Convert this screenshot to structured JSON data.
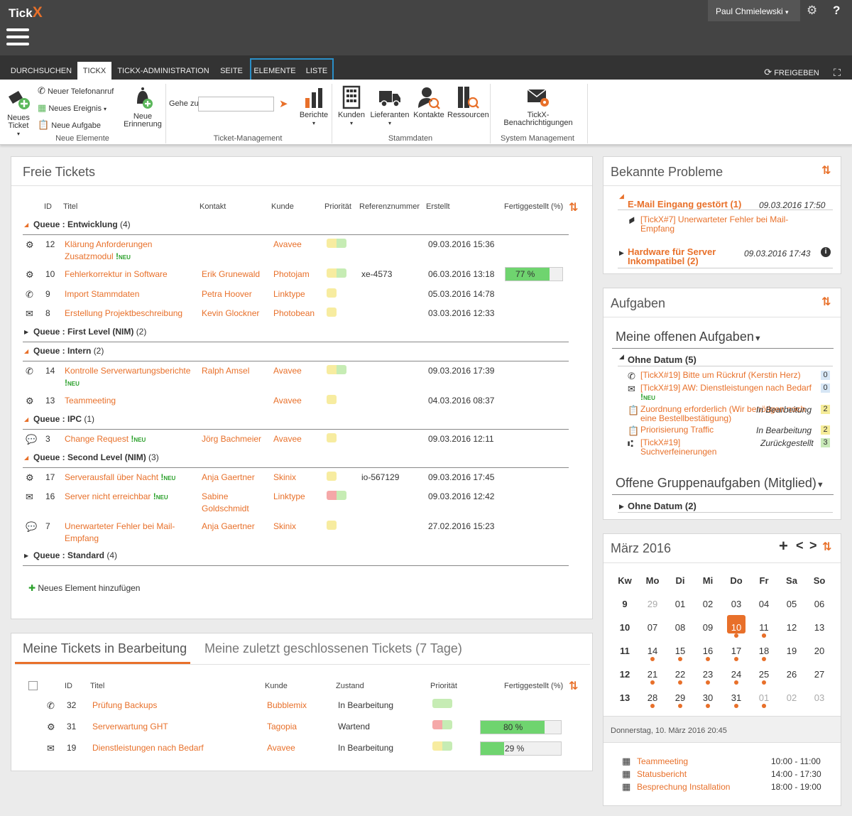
{
  "app": {
    "logo_text": "Tick",
    "logo_x": "X",
    "user": "Paul Chmielewski",
    "settings_icon": "gear-icon",
    "help_icon": "?"
  },
  "tabs": [
    {
      "label": "DURCHSUCHEN"
    },
    {
      "label": "TICKX"
    },
    {
      "label": "TICKX-ADMINISTRATION"
    },
    {
      "label": "SEITE"
    },
    {
      "label": "ELEMENTE"
    },
    {
      "label": "LISTE"
    }
  ],
  "toolbar_right": {
    "share": "FREIGEBEN"
  },
  "ribbon": {
    "neues_ticket": "Neues Ticket",
    "neuer_telefonanruf": "Neuer Telefonanruf",
    "neues_ereignis": "Neues Ereignis",
    "neue_aufgabe": "Neue Aufgabe",
    "neue_erinnerung": "Neue Erinnerung",
    "group_neue": "Neue Elemente",
    "gehe_zu": "Gehe zu",
    "berichte": "Berichte",
    "group_ticket": "Ticket-Management",
    "kunden": "Kunden",
    "lieferanten": "Lieferanten",
    "kontakte": "Kontakte",
    "ressourcen": "Ressourcen",
    "group_stamm": "Stammdaten",
    "benachrichtigungen": "TickX-Benachrichtigungen",
    "group_system": "System Management"
  },
  "freie": {
    "title": "Freie Tickets",
    "add": "Neues Element hinzufügen",
    "headers": {
      "id": "ID",
      "titel": "Titel",
      "kontakt": "Kontakt",
      "kunde": "Kunde",
      "prio": "Priorität",
      "ref": "Referenznummer",
      "erstellt": "Erstellt",
      "fertig": "Fertiggestellt (%)"
    },
    "queues": [
      {
        "name": "Queue : Entwicklung",
        "count": "(4)"
      },
      {
        "name": "Queue : First Level (NIM)",
        "count": "(2)"
      },
      {
        "name": "Queue : Intern",
        "count": "(2)"
      },
      {
        "name": "Queue : IPC",
        "count": "(1)"
      },
      {
        "name": "Queue : Second Level (NIM)",
        "count": "(3)"
      },
      {
        "name": "Queue : Standard",
        "count": "(4)"
      }
    ],
    "rows": [
      {
        "id": "12",
        "titel": "Klärung Anforderungen Zusatzmodul",
        "kontakt": "",
        "kunde": "Avavee",
        "ref": "",
        "erstellt": "09.03.2016 15:36"
      },
      {
        "id": "10",
        "titel": "Fehlerkorrektur in Software",
        "kontakt": "Erik Grunewald",
        "kunde": "Photojam",
        "ref": "xe-4573",
        "erstellt": "06.03.2016 13:18",
        "fertig": "77 %",
        "fertig_value": 77
      },
      {
        "id": "9",
        "titel": "Import Stammdaten",
        "kontakt": "Petra Hoover",
        "kunde": "Linktype",
        "ref": "",
        "erstellt": "05.03.2016 14:78"
      },
      {
        "id": "8",
        "titel": "Erstellung Projektbeschreibung",
        "kontakt": "Kevin Glockner",
        "kunde": "Photobean",
        "ref": "",
        "erstellt": "03.03.2016 12:33"
      },
      {
        "id": "14",
        "titel": "Kontrolle Serverwartungsberichte",
        "kontakt": "Ralph Amsel",
        "kunde": "Avavee",
        "ref": "",
        "erstellt": "09.03.2016 17:39"
      },
      {
        "id": "13",
        "titel": "Teammeeting",
        "kontakt": "",
        "kunde": "Avavee",
        "ref": "",
        "erstellt": "04.03.2016 08:37"
      },
      {
        "id": "3",
        "titel": "Change Request",
        "kontakt": "Jörg Bachmeier",
        "kunde": "Avavee",
        "ref": "",
        "erstellt": "09.03.2016 12:11"
      },
      {
        "id": "17",
        "titel": "Serverausfall über Nacht",
        "kontakt": "Anja Gaertner",
        "kunde": "Skinix",
        "ref": "io-567129",
        "erstellt": "09.03.2016 17:45"
      },
      {
        "id": "16",
        "titel": "Server nicht erreichbar",
        "kontakt": "Sabine Goldschmidt",
        "kunde": "Linktype",
        "ref": "",
        "erstellt": "09.03.2016 12:42"
      },
      {
        "id": "7",
        "titel": "Unerwarteter Fehler bei Mail-Empfang",
        "kontakt": "Anja Gaertner",
        "kunde": "Skinix",
        "ref": "",
        "erstellt": "27.02.2016 15:23"
      }
    ],
    "neu_mark": "!",
    "neu_text": "NEU"
  },
  "meine": {
    "tab1": "Meine Tickets in Bearbeitung",
    "tab2": "Meine zuletzt geschlossenen Tickets (7 Tage)",
    "headers": {
      "id": "ID",
      "titel": "Titel",
      "kunde": "Kunde",
      "zustand": "Zustand",
      "prio": "Priorität",
      "fertig": "Fertiggestellt (%)"
    },
    "rows": [
      {
        "id": "32",
        "titel": "Prüfung Backups",
        "kunde": "Bubblemix",
        "zustand": "In Bearbeitung"
      },
      {
        "id": "31",
        "titel": "Serverwartung GHT",
        "kunde": "Tagopia",
        "zustand": "Wartend",
        "fertig": "80 %",
        "fertig_value": 80
      },
      {
        "id": "19",
        "titel": "Dienstleistungen nach Bedarf",
        "kunde": "Avavee",
        "zustand": "In Bearbeitung",
        "fertig": "29 %",
        "fertig_value": 29
      }
    ]
  },
  "probleme": {
    "title": "Bekannte Probleme",
    "items": [
      {
        "title": "E-Mail Eingang gestört (1)",
        "date": "09.03.2016 17:50",
        "sub": "[TickX#7] Unerwarteter Fehler bei Mail-Empfang"
      },
      {
        "title": "Hardware für Server Inkompatibel (2)",
        "date": "09.03.2016 17:43"
      }
    ]
  },
  "aufgaben": {
    "title": "Aufgaben",
    "meine": "Meine offenen Aufgaben",
    "ohne": "Ohne Datum (5)",
    "items": [
      {
        "text": "[TickX#19] Bitte um Rückruf (Kerstin Herz)",
        "status": "",
        "badge": "0"
      },
      {
        "text": "[TickX#19] AW: Dienstleistungen nach Bedarf",
        "status": "",
        "badge": "0"
      },
      {
        "text": "Zuordnung erforderlich (Wir benötigen noch eine Bestellbestätigung)",
        "status": "In Bearbeitung",
        "badge": "2"
      },
      {
        "text": "Priorisierung Traffic",
        "status": "In Bearbeitung",
        "badge": "2"
      },
      {
        "text": "[TickX#19] Suchverfeinerungen",
        "status": "Zurückgestellt",
        "badge": "3"
      }
    ],
    "gruppe": "Offene Gruppenaufgaben (Mitglied)",
    "gruppe_ohne": "Ohne Datum (2)"
  },
  "kalender": {
    "title": "März 2016",
    "plus": "+",
    "prev": "<",
    "next": ">",
    "headers": [
      "Kw",
      "Mo",
      "Di",
      "Mi",
      "Do",
      "Fr",
      "Sa",
      "So"
    ],
    "weeks": [
      {
        "kw": "9",
        "days": [
          "29",
          "01",
          "02",
          "03",
          "04",
          "05",
          "06"
        ]
      },
      {
        "kw": "10",
        "days": [
          "07",
          "08",
          "09",
          "10",
          "11",
          "12",
          "13"
        ]
      },
      {
        "kw": "11",
        "days": [
          "14",
          "15",
          "16",
          "17",
          "18",
          "19",
          "20"
        ]
      },
      {
        "kw": "12",
        "days": [
          "21",
          "22",
          "23",
          "24",
          "25",
          "26",
          "27"
        ]
      },
      {
        "kw": "13",
        "days": [
          "28",
          "29",
          "30",
          "31",
          "01",
          "02",
          "03"
        ]
      }
    ],
    "selected_date": "Donnerstag, 10. März 2016 20:45",
    "events": [
      {
        "name": "Teammeeting",
        "time": "10:00 - 11:00"
      },
      {
        "name": "Statusbericht",
        "time": "14:00 - 17:30"
      },
      {
        "name": "Besprechung Installation",
        "time": "18:00 - 19:00"
      }
    ]
  },
  "colors": {
    "accent": "#e8702a",
    "topbar": "#444444",
    "tabbar": "#333333",
    "context_tab": "#2a8fc8",
    "progress": "#6fd46f",
    "prio_yellow": "#f7eca0",
    "prio_green": "#c6ecb4",
    "prio_red": "#f5a8a8"
  }
}
